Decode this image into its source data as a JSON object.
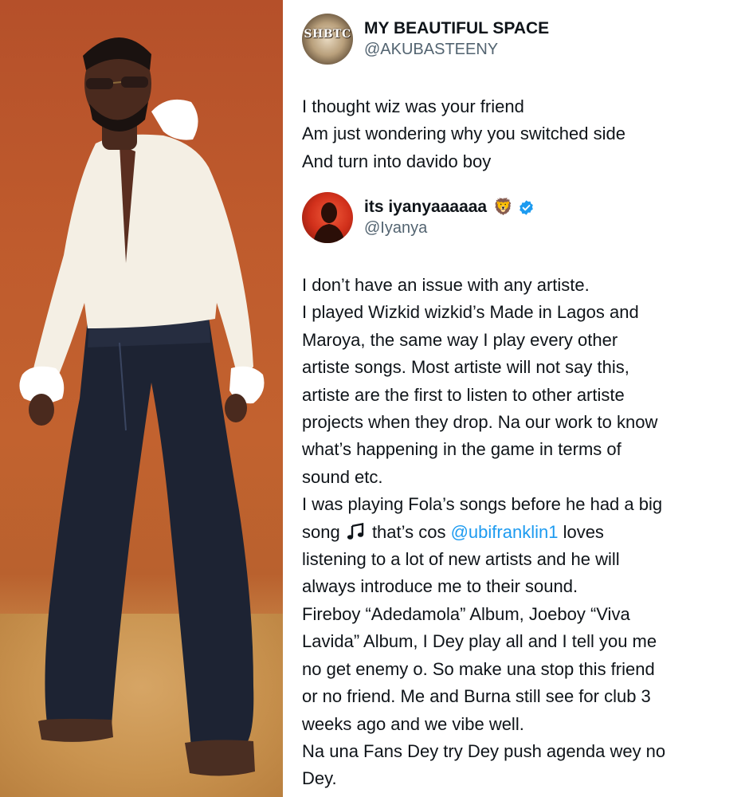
{
  "photo": {
    "alt": "Man in white ruffled shirt and wide-leg dark jeans against orange backdrop"
  },
  "tweet": {
    "user": {
      "display_name": "MY BEAUTIFUL SPACE",
      "handle": "@AKUBASTEENY",
      "avatar_text": "SHBTC"
    },
    "lines": [
      "I thought wiz was your friend",
      "Am just wondering why you switched side",
      "And turn into davido boy"
    ]
  },
  "reply": {
    "user": {
      "display_name": "its iyanyaaaaaa",
      "emoji": "🦁",
      "handle": "@Iyanya",
      "verified": true,
      "verified_color": "#1d9bf0"
    },
    "lines": [
      "I don’t have an issue with any artiste.",
      "I played Wizkid wizkid’s Made in Lagos and",
      "Maroya, the same way I play every other",
      "artiste songs. Most artiste will not say this,",
      "artiste are the first to listen to other artiste",
      "projects when they drop. Na our work to know",
      "what’s happening in the game in terms of",
      "sound etc.",
      "I was playing Fola’s songs before he had a big"
    ],
    "song_line": {
      "before": "song ",
      "icon": "music-note-icon",
      "middle": " that’s cos ",
      "mention": "@ubifranklin1",
      "after": " loves"
    },
    "lines_after": [
      "listening to a lot of new artists and he will",
      "always introduce me to their sound.",
      "Fireboy “Adedamola” Album, Joeboy “Viva",
      "Lavida” Album, I Dey play all and I tell you me",
      "no get enemy o. So make una stop this friend",
      "or no friend. Me and Burna still see for club 3",
      "weeks ago and we vibe well.",
      "Na una Fans Dey try Dey push agenda wey no",
      "Dey."
    ]
  },
  "colors": {
    "link": "#1d9bf0",
    "text": "#0f1419",
    "secondary": "#536471",
    "backdrop": "#bf5b2d"
  }
}
